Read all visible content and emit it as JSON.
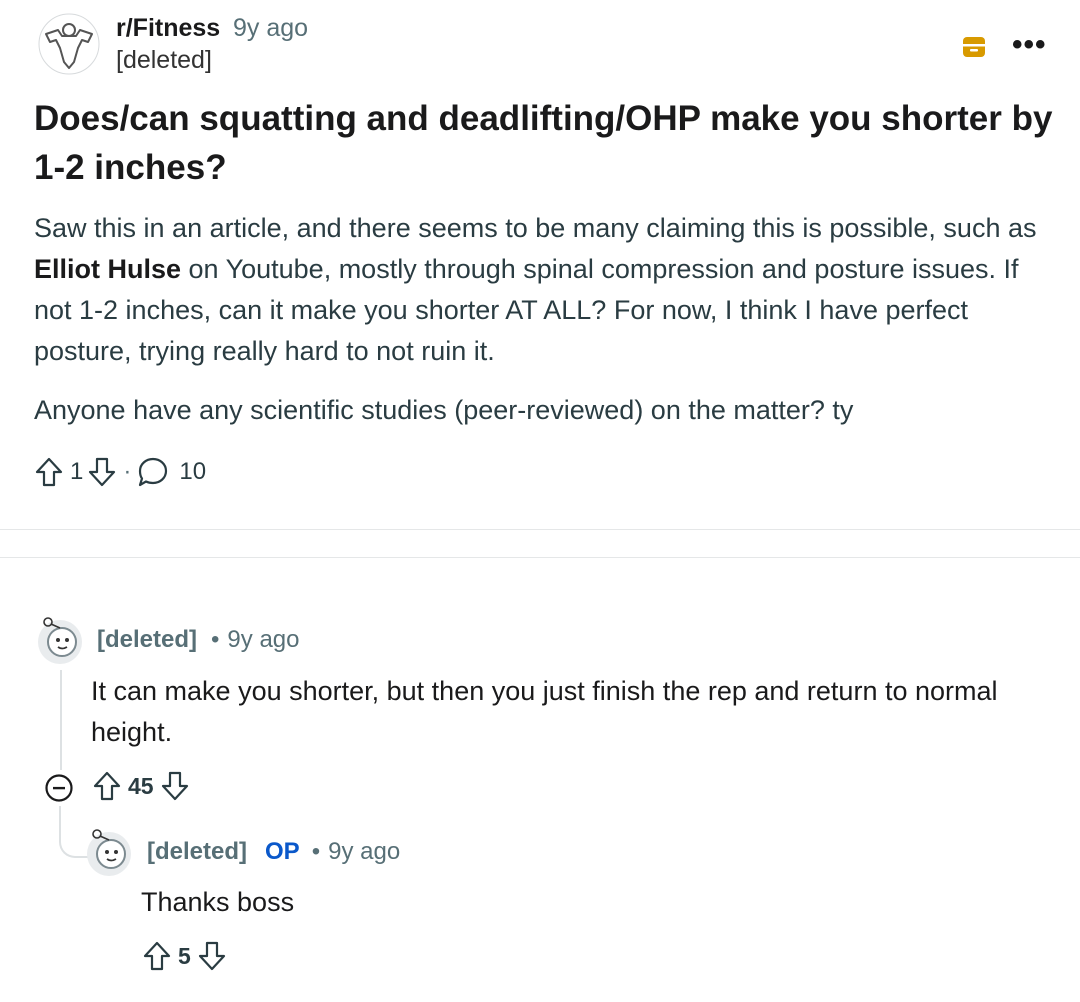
{
  "post": {
    "subreddit": "r/Fitness",
    "time": "9y ago",
    "author": "[deleted]",
    "title": "Does/can squatting and deadlifting/OHP make you shorter by 1-2 inches?",
    "body_part1": "Saw this in an article, and there seems to be many claiming this is possible, such as ",
    "body_bold": "Elliot Hulse",
    "body_part2": " on Youtube, mostly through spinal compression and posture issues. If not 1-2 inches, can it make you shorter AT ALL? For now, I think I have perfect posture, trying really hard to not ruin it.",
    "body_paragraph2": "Anyone have any scientific studies (peer-reviewed) on the matter? ty",
    "score": "1",
    "comment_count": "10",
    "separator_dot": "·",
    "more_label": "•••"
  },
  "comments": [
    {
      "author": "[deleted]",
      "dot": "•",
      "time": "9y ago",
      "text": "It can make you shorter, but then you just finish the rep and return to normal height.",
      "score": "45"
    },
    {
      "author": "[deleted]",
      "op_badge": "OP",
      "dot": "•",
      "time": "9y ago",
      "text": "Thanks boss",
      "score": "5"
    }
  ],
  "colors": {
    "archive_icon": "#d89a00",
    "op_badge": "#0a58ca",
    "meta_text": "#576f76",
    "divider": "#e5e7e8"
  }
}
